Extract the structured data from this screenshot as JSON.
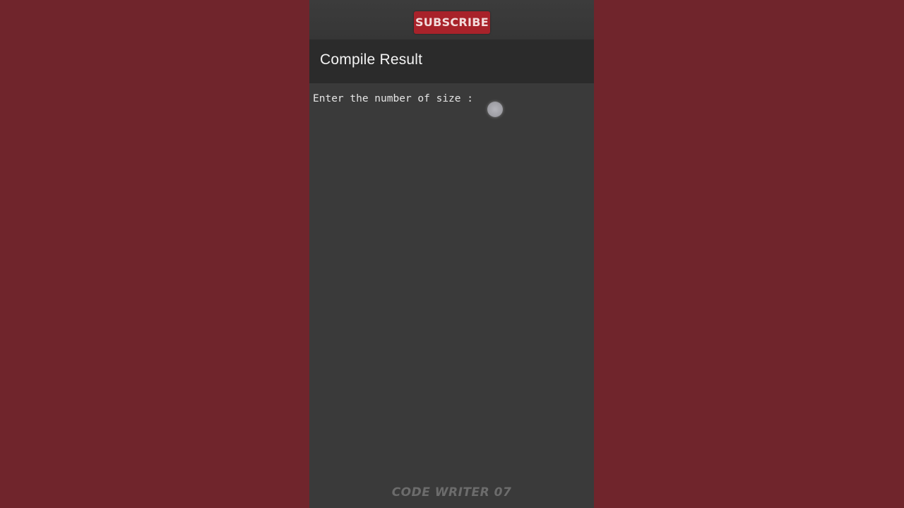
{
  "overlay": {
    "subscribe_label": "SUBSCRIBE"
  },
  "appbar": {
    "title": "Compile Result"
  },
  "console": {
    "output": "Enter the number of size :"
  },
  "watermark": {
    "text": "CODE WRITER 07"
  },
  "colors": {
    "side_background": "#70252c",
    "console_background": "#3a3a3a",
    "appbar_background": "#2b2b2b",
    "subscribe_button": "#a8222a"
  }
}
